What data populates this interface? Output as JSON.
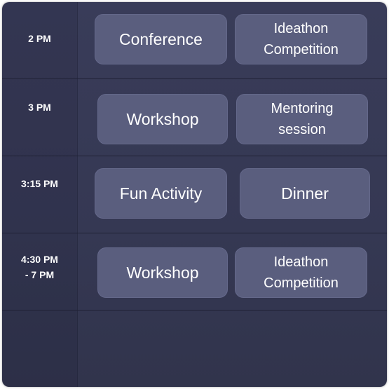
{
  "schedule": {
    "rows": [
      {
        "time_line1": "2 PM",
        "time_line2": "",
        "events": [
          {
            "label": "Conference"
          },
          {
            "label_line1": "Ideathon",
            "label_line2": "Competition"
          }
        ]
      },
      {
        "time_line1": "3 PM",
        "time_line2": "",
        "events": [
          {
            "label": "Workshop"
          },
          {
            "label_line1": "Mentoring",
            "label_line2": "session"
          }
        ]
      },
      {
        "time_line1": "3:15 PM",
        "time_line2": "",
        "events": [
          {
            "label": "Fun Activity"
          },
          {
            "label": "Dinner"
          }
        ]
      },
      {
        "time_line1": "4:30 PM",
        "time_line2": "- 7 PM",
        "events": [
          {
            "label": "Workshop"
          },
          {
            "label_line1": "Ideathon",
            "label_line2": "Competition"
          }
        ]
      }
    ]
  },
  "colors": {
    "panel_bg": "#373a56",
    "card_bg": "#5a5e7e",
    "text": "#ffffff",
    "separator": "#1f2135"
  }
}
